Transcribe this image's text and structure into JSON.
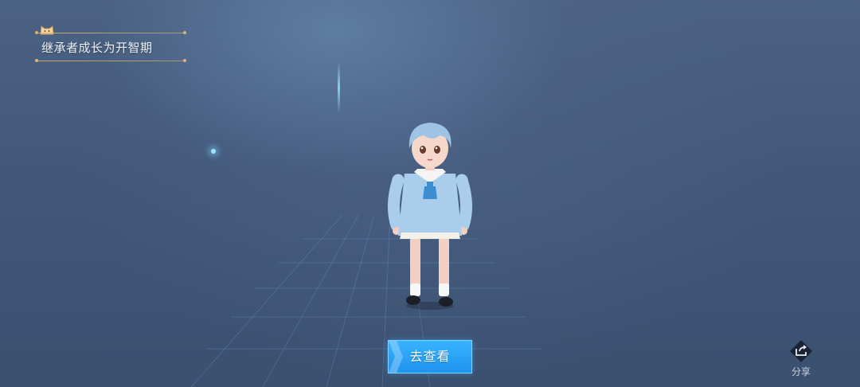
{
  "notice": {
    "text": "继承者成长为开智期",
    "badge_icon": "cat-face-icon",
    "accent_color": "#d8b47a"
  },
  "scene": {
    "character": "heir-child-character",
    "background_color": "#42587a"
  },
  "actions": {
    "go_view_label": "去查看",
    "go_view_color": "#2aa3f8",
    "share_label": "分享",
    "share_icon": "share-icon"
  }
}
